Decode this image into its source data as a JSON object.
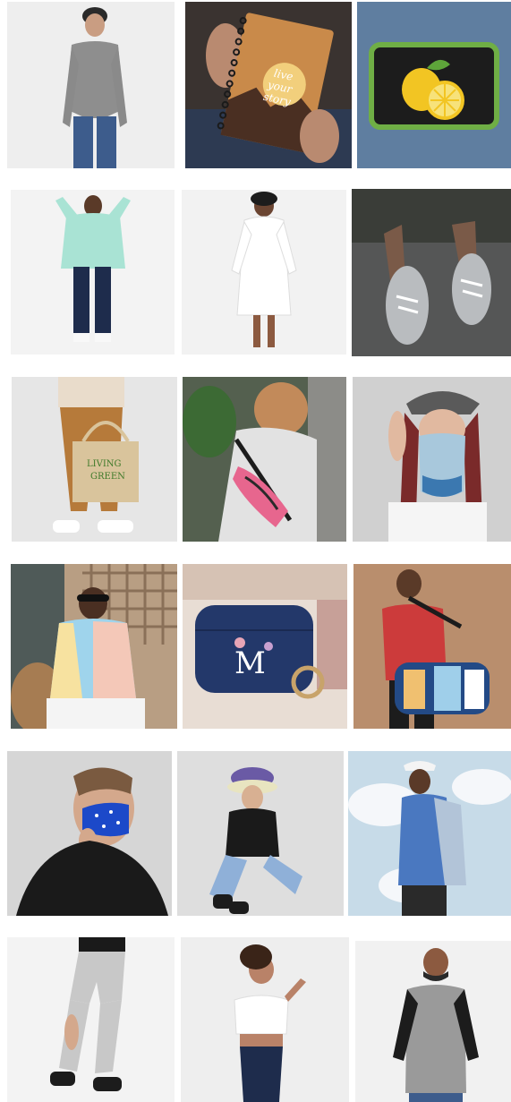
{
  "gallery": {
    "items": [
      {
        "id": "grey-sweatshirt",
        "bg": "#eeeeee",
        "accent": "#8e8e8e"
      },
      {
        "id": "spiral-notebook",
        "bg": "#3a3330",
        "accent": "#c98a4a",
        "text": [
          "live",
          "your",
          "story"
        ]
      },
      {
        "id": "lemon-patch",
        "bg": "#5f7ea0",
        "accent": "#f2c523"
      },
      {
        "id": "mint-windbreaker",
        "bg": "#f3f3f3",
        "accent": "#a9e3d4"
      },
      {
        "id": "white-robe",
        "bg": "#f2f2f2",
        "accent": "#ffffff"
      },
      {
        "id": "grey-sneakers",
        "bg": "#555656",
        "accent": "#b9bcbf"
      },
      {
        "id": "tote-bag",
        "bg": "#e6e6e6",
        "accent": "#d9c49c",
        "text": [
          "LIVING",
          "GREEN"
        ]
      },
      {
        "id": "fanny-pack",
        "bg": "#54604f",
        "accent": "#e7668e"
      },
      {
        "id": "neck-gaiter",
        "bg": "#d0d0d0",
        "accent": "#a8c8dc"
      },
      {
        "id": "color-block-jacket",
        "bg": "#b89e83",
        "accent": "#9fd4ec"
      },
      {
        "id": "airpods-case",
        "bg": "#e8ddd4",
        "accent": "#23386a",
        "text": [
          "M"
        ]
      },
      {
        "id": "duffle-bag",
        "bg": "#b98e6d",
        "accent": "#234a86"
      },
      {
        "id": "face-mask",
        "bg": "#d6d6d6",
        "accent": "#1c49c9"
      },
      {
        "id": "bucket-hat",
        "bg": "#dedede",
        "accent": "#6a5aa5"
      },
      {
        "id": "hoodie-sky",
        "bg": "#c7dbe8",
        "accent": "#b2c4d8"
      },
      {
        "id": "grey-joggers",
        "bg": "#f3f3f3",
        "accent": "#c8c8c8"
      },
      {
        "id": "crop-top",
        "bg": "#eeeeee",
        "accent": "#ffffff"
      },
      {
        "id": "raglan-tee",
        "bg": "#f1f1f1",
        "accent": "#9a9a9a"
      }
    ]
  }
}
